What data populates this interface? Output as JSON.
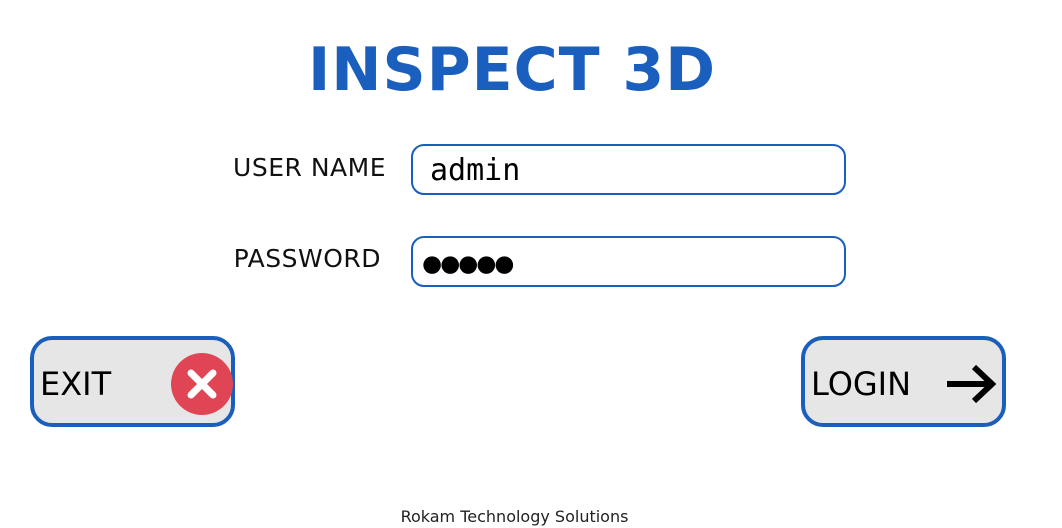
{
  "app": {
    "title": "INSPECT 3D"
  },
  "form": {
    "username_label": "USER NAME",
    "username_value": "admin",
    "password_label": "PASSWORD",
    "password_masked": "●●●●●"
  },
  "buttons": {
    "exit_label": "EXIT",
    "exit_icon": "close-icon",
    "login_label": "LOGIN",
    "login_icon": "arrow-right-icon"
  },
  "footer": {
    "company": "Rokam Technology Solutions"
  },
  "colors": {
    "brand_blue": "#1a5fbd",
    "exit_red": "#e04556",
    "button_bg": "#e6e6e6"
  }
}
